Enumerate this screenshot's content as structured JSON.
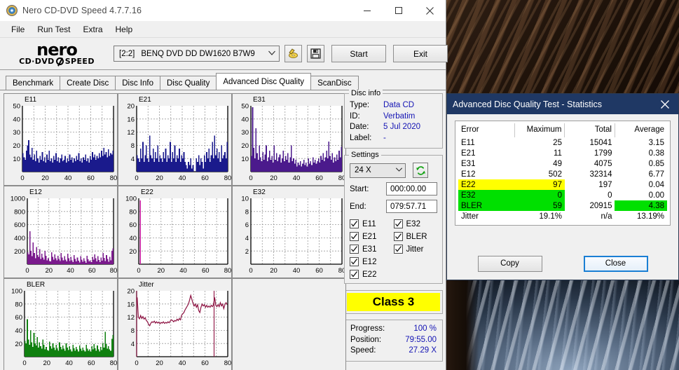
{
  "window": {
    "title": "Nero CD-DVD Speed 4.7.7.16",
    "icon": "disc-icon",
    "minimize": "minimize-icon",
    "maximize": "maximize-icon",
    "close": "close-icon"
  },
  "menu": [
    {
      "label": "File"
    },
    {
      "label": "Run Test"
    },
    {
      "label": "Extra"
    },
    {
      "label": "Help"
    }
  ],
  "brand": {
    "word": "nero",
    "sub_left": "CD·DVD",
    "sub_right": "SPEED"
  },
  "toolbar": {
    "drive_index": "[2:2]",
    "drive_name": "BENQ DVD DD DW1620 B7W9",
    "eject_icon": "eject-disc-icon",
    "save_icon": "floppy-save-icon",
    "start_label": "Start",
    "exit_label": "Exit"
  },
  "tabs": [
    {
      "label": "Benchmark",
      "active": false
    },
    {
      "label": "Create Disc",
      "active": false
    },
    {
      "label": "Disc Info",
      "active": false
    },
    {
      "label": "Disc Quality",
      "active": false
    },
    {
      "label": "Advanced Disc Quality",
      "active": true
    },
    {
      "label": "ScanDisc",
      "active": false
    }
  ],
  "disc_info": {
    "legend": "Disc info",
    "rows": [
      {
        "key": "Type:",
        "value": "Data CD"
      },
      {
        "key": "ID:",
        "value": "Verbatim"
      },
      {
        "key": "Date:",
        "value": "5 Jul 2020"
      },
      {
        "key": "Label:",
        "value": "-"
      }
    ]
  },
  "settings": {
    "legend": "Settings",
    "speed": "24 X",
    "refresh_icon": "refresh-icon",
    "start_label": "Start:",
    "start_value": "000:00.00",
    "end_label": "End:",
    "end_value": "079:57.71",
    "checkboxes": [
      {
        "label": "E11",
        "checked": true
      },
      {
        "label": "E32",
        "checked": true
      },
      {
        "label": "E21",
        "checked": true
      },
      {
        "label": "BLER",
        "checked": true
      },
      {
        "label": "E31",
        "checked": true
      },
      {
        "label": "Jitter",
        "checked": true
      },
      {
        "label": "E12",
        "checked": true
      },
      {
        "label": "",
        "checked": false
      },
      {
        "label": "E22",
        "checked": true
      },
      {
        "label": "",
        "checked": false
      }
    ]
  },
  "class_badge": "Class 3",
  "progress": [
    {
      "key": "Progress:",
      "value": "100 %"
    },
    {
      "key": "Position:",
      "value": "79:55.00"
    },
    {
      "key": "Speed:",
      "value": "27.29 X"
    }
  ],
  "stats_dialog": {
    "title": "Advanced Disc Quality Test - Statistics",
    "close_icon": "close-icon",
    "headers": [
      "Error",
      "Maximum",
      "Total",
      "Average"
    ],
    "rows": [
      {
        "error": "E11",
        "maximum": "25",
        "total": "15041",
        "average": "3.15",
        "hl_error": "",
        "hl_max": "",
        "hl_avg": ""
      },
      {
        "error": "E21",
        "maximum": "11",
        "total": "1799",
        "average": "0.38",
        "hl_error": "",
        "hl_max": "",
        "hl_avg": ""
      },
      {
        "error": "E31",
        "maximum": "49",
        "total": "4075",
        "average": "0.85",
        "hl_error": "",
        "hl_max": "",
        "hl_avg": ""
      },
      {
        "error": "E12",
        "maximum": "502",
        "total": "32314",
        "average": "6.77",
        "hl_error": "",
        "hl_max": "",
        "hl_avg": ""
      },
      {
        "error": "E22",
        "maximum": "97",
        "total": "197",
        "average": "0.04",
        "hl_error": "hl-yellow",
        "hl_max": "hl-yellow",
        "hl_avg": ""
      },
      {
        "error": "E32",
        "maximum": "0",
        "total": "0",
        "average": "0.00",
        "hl_error": "hl-green",
        "hl_max": "hl-green",
        "hl_avg": ""
      },
      {
        "error": "BLER",
        "maximum": "59",
        "total": "20915",
        "average": "4.38",
        "hl_error": "hl-green",
        "hl_max": "hl-green",
        "hl_avg": "hl-green"
      },
      {
        "error": "Jitter",
        "maximum": "19.1%",
        "total": "n/a",
        "average": "13.19%",
        "hl_error": "",
        "hl_max": "",
        "hl_avg": ""
      }
    ],
    "copy_label": "Copy",
    "close_label": "Close"
  },
  "colors": {
    "e11_fill": "#1a1a8c",
    "e21_fill": "#1a1a8c",
    "e31_fill": "#4b1a8c",
    "e12_fill": "#7a1a8c",
    "e22_fill": "#c4189c",
    "bler_fill": "#108010",
    "jitter_line": "#8c1040",
    "highlight_yellow": "#ffff00",
    "highlight_green": "#00e000",
    "dialog_title_bg": "#1f3864",
    "value_blue": "#1414b4"
  },
  "chart_data": [
    {
      "id": "e11",
      "type": "area",
      "title": "E11",
      "color": "#1a1a8c",
      "xlabel": "",
      "ylabel": "",
      "xlim": [
        0,
        80
      ],
      "ylim": [
        0,
        50
      ],
      "xticks": [
        0,
        20,
        40,
        60,
        80
      ],
      "yticks": [
        10,
        20,
        30,
        40,
        50
      ],
      "grid": true,
      "values": [
        14,
        11,
        9,
        16,
        20,
        24,
        13,
        11,
        18,
        9,
        13,
        8,
        16,
        10,
        7,
        12,
        9,
        15,
        8,
        11,
        7,
        13,
        9,
        16,
        8,
        10,
        7,
        12,
        9,
        14,
        8,
        11,
        7,
        10,
        13,
        8,
        9,
        12,
        7,
        10,
        8,
        13,
        9,
        11,
        7,
        10,
        8,
        12,
        9,
        14,
        8,
        10,
        7,
        11,
        9,
        13,
        8,
        10,
        7,
        12,
        9,
        15,
        11,
        13,
        9,
        12,
        10,
        14,
        11,
        16,
        12,
        18,
        13,
        15,
        11,
        17,
        12,
        14,
        13,
        16
      ]
    },
    {
      "id": "e21",
      "type": "area",
      "title": "E21",
      "color": "#1a1a8c",
      "xlabel": "",
      "ylabel": "",
      "xlim": [
        0,
        80
      ],
      "ylim": [
        0,
        20
      ],
      "xticks": [
        0,
        20,
        40,
        60,
        80
      ],
      "yticks": [
        4,
        8,
        12,
        16,
        20
      ],
      "grid": true,
      "values": [
        5,
        4,
        3,
        7,
        4,
        9,
        3,
        5,
        8,
        4,
        3,
        11,
        5,
        4,
        7,
        3,
        6,
        4,
        8,
        3,
        5,
        4,
        3,
        6,
        4,
        7,
        3,
        5,
        4,
        9,
        3,
        6,
        4,
        8,
        3,
        5,
        4,
        7,
        3,
        5,
        4,
        6,
        3,
        2,
        1,
        3,
        2,
        4,
        1,
        2,
        0,
        0,
        4,
        3,
        5,
        2,
        4,
        3,
        1,
        5,
        3,
        6,
        4,
        7,
        3,
        5,
        9,
        4,
        11,
        5,
        7,
        4,
        6,
        3,
        8,
        4,
        5,
        6,
        4,
        9
      ]
    },
    {
      "id": "e31",
      "type": "area",
      "title": "E31",
      "color": "#4b1a8c",
      "xlabel": "",
      "ylabel": "",
      "xlim": [
        0,
        80
      ],
      "ylim": [
        0,
        50
      ],
      "xticks": [
        0,
        20,
        40,
        60,
        80
      ],
      "yticks": [
        10,
        20,
        30,
        40,
        50
      ],
      "grid": true,
      "values": [
        12,
        49,
        18,
        10,
        33,
        14,
        9,
        20,
        11,
        8,
        15,
        9,
        13,
        20,
        8,
        11,
        16,
        9,
        12,
        7,
        20,
        9,
        14,
        8,
        11,
        13,
        7,
        10,
        16,
        8,
        12,
        9,
        14,
        7,
        11,
        20,
        8,
        10,
        6,
        9,
        4,
        7,
        5,
        8,
        4,
        6,
        9,
        5,
        7,
        4,
        10,
        6,
        8,
        5,
        11,
        7,
        9,
        6,
        8,
        10,
        7,
        12,
        9,
        14,
        8,
        11,
        16,
        10,
        23,
        12,
        9,
        14,
        7,
        11,
        8,
        13,
        9,
        16,
        11,
        19
      ]
    },
    {
      "id": "e12",
      "type": "area",
      "title": "E12",
      "color": "#7a1a8c",
      "xlabel": "",
      "ylabel": "",
      "xlim": [
        0,
        80
      ],
      "ylim": [
        0,
        1000
      ],
      "xticks": [
        0,
        20,
        40,
        60,
        80
      ],
      "yticks": [
        200,
        400,
        600,
        800,
        1000
      ],
      "grid": true,
      "values": [
        180,
        150,
        502,
        200,
        120,
        330,
        170,
        90,
        260,
        140,
        110,
        230,
        80,
        160,
        100,
        70,
        200,
        130,
        60,
        90,
        50,
        40,
        180,
        110,
        70,
        150,
        90,
        60,
        130,
        80,
        50,
        170,
        100,
        60,
        120,
        70,
        40,
        160,
        90,
        50,
        110,
        60,
        30,
        140,
        80,
        40,
        100,
        55,
        25,
        120,
        70,
        35,
        90,
        50,
        20,
        130,
        75,
        40,
        60,
        30,
        110,
        70,
        150,
        90,
        45,
        120,
        65,
        30,
        100,
        55,
        170,
        95,
        50,
        140,
        80,
        35,
        110,
        60,
        200,
        240
      ]
    },
    {
      "id": "e22",
      "type": "area",
      "title": "E22",
      "color": "#c4189c",
      "xlabel": "",
      "ylabel": "",
      "xlim": [
        0,
        80
      ],
      "ylim": [
        0,
        100
      ],
      "xticks": [
        0,
        20,
        40,
        60,
        80
      ],
      "yticks": [
        20,
        40,
        60,
        80,
        100
      ],
      "grid": true,
      "spike_x": 1,
      "spike_y": 97,
      "values": [
        0,
        97,
        0,
        0,
        0,
        0,
        0,
        0,
        0,
        0,
        0,
        0,
        0,
        0,
        0,
        0,
        0,
        0,
        0,
        0,
        0,
        0,
        0,
        0,
        0,
        0,
        0,
        0,
        0,
        0,
        0,
        0,
        0,
        0,
        0,
        0,
        0,
        0,
        0,
        0,
        0,
        0,
        0,
        0,
        0,
        0,
        0,
        0,
        0,
        0,
        0,
        0,
        0,
        0,
        0,
        0,
        0,
        0,
        0,
        0,
        0,
        0,
        0,
        0,
        0,
        0,
        0,
        0,
        0,
        0,
        0,
        0,
        0,
        0,
        0,
        0,
        0,
        0,
        0,
        0
      ]
    },
    {
      "id": "e32",
      "type": "area",
      "title": "E32",
      "color": "#4b1a8c",
      "xlabel": "",
      "ylabel": "",
      "xlim": [
        0,
        80
      ],
      "ylim": [
        0,
        10
      ],
      "xticks": [
        0,
        20,
        40,
        60,
        80
      ],
      "yticks": [
        2,
        4,
        6,
        8,
        10
      ],
      "grid": true,
      "values": [
        0,
        0,
        0,
        0,
        0,
        0,
        0,
        0,
        0,
        0,
        0,
        0,
        0,
        0,
        0,
        0,
        0,
        0,
        0,
        0,
        0,
        0,
        0,
        0,
        0,
        0,
        0,
        0,
        0,
        0,
        0,
        0,
        0,
        0,
        0,
        0,
        0,
        0,
        0,
        0,
        0,
        0,
        0,
        0,
        0,
        0,
        0,
        0,
        0,
        0,
        0,
        0,
        0,
        0,
        0,
        0,
        0,
        0,
        0,
        0,
        0,
        0,
        0,
        0,
        0,
        0,
        0,
        0,
        0,
        0,
        0,
        0,
        0,
        0,
        0,
        0,
        0,
        0,
        0,
        0
      ]
    },
    {
      "id": "bler",
      "type": "area",
      "title": "BLER",
      "color": "#108010",
      "xlabel": "",
      "ylabel": "",
      "xlim": [
        0,
        80
      ],
      "ylim": [
        0,
        100
      ],
      "xticks": [
        0,
        20,
        40,
        60,
        80
      ],
      "yticks": [
        20,
        40,
        60,
        80,
        100
      ],
      "grid": true,
      "values": [
        24,
        20,
        57,
        26,
        18,
        40,
        22,
        15,
        36,
        20,
        17,
        30,
        14,
        22,
        16,
        12,
        26,
        18,
        11,
        15,
        10,
        9,
        23,
        16,
        12,
        20,
        14,
        10,
        18,
        13,
        9,
        22,
        15,
        11,
        17,
        12,
        9,
        20,
        14,
        10,
        16,
        11,
        8,
        18,
        13,
        9,
        15,
        11,
        8,
        17,
        12,
        9,
        14,
        10,
        8,
        18,
        12,
        9,
        11,
        8,
        16,
        11,
        19,
        13,
        9,
        17,
        11,
        8,
        15,
        10,
        21,
        14,
        38,
        19,
        12,
        16,
        11,
        9,
        27,
        33
      ]
    },
    {
      "id": "jitter",
      "type": "line",
      "title": "Jitter",
      "color": "#8c1040",
      "xlabel": "",
      "ylabel": "",
      "xlim": [
        0,
        80
      ],
      "ylim": [
        0,
        20
      ],
      "xticks": [
        0,
        20,
        40,
        60,
        80
      ],
      "yticks": [
        4,
        8,
        12,
        16,
        20
      ],
      "grid": true,
      "marker_x": [
        0,
        68
      ],
      "values": [
        18,
        12,
        11.5,
        12.5,
        11.6,
        12.2,
        11.4,
        11.8,
        11,
        10.6,
        9.8,
        9.4,
        10.2,
        10.6,
        10.4,
        10.8,
        10.2,
        10.6,
        10.2,
        10.5,
        10,
        10.4,
        10.2,
        10.6,
        10.1,
        10.4,
        10.2,
        10.6,
        10.3,
        10.8,
        11.2,
        11,
        10.6,
        11,
        10.8,
        11.4,
        11,
        11.6,
        11.2,
        12.6,
        13,
        13.4,
        14.2,
        14.8,
        15.4,
        16,
        17.2,
        18.6,
        17.4,
        16.2,
        15.4,
        16,
        15,
        15.8,
        14,
        13.4,
        15,
        16,
        15.4,
        15.8,
        15,
        15.6,
        15,
        15.4,
        15,
        15.6,
        15.2,
        15.8,
        18,
        15.6,
        15.2,
        15.8,
        15.2,
        16.4,
        15.4,
        16,
        14.6,
        15.8,
        16.4,
        15.8
      ]
    }
  ]
}
